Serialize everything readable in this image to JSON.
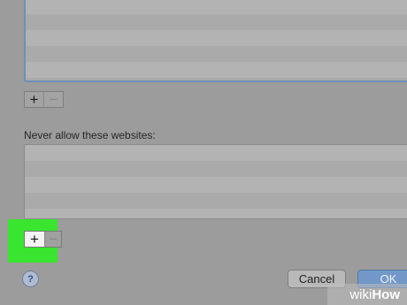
{
  "allowed_list": {
    "rows": []
  },
  "allowed_controls": {
    "add": "+",
    "remove": "−"
  },
  "blocked_list": {
    "label": "Never allow these websites:",
    "rows": []
  },
  "blocked_controls": {
    "add": "+",
    "remove": "−"
  },
  "footer": {
    "help": "?",
    "cancel": "Cancel",
    "ok": "OK"
  },
  "watermark": {
    "part1": "wiki",
    "part2": "How"
  },
  "colors": {
    "highlight": "#39e52e",
    "ok_button": "#7298c8",
    "focus_border": "#6f8fb5"
  }
}
